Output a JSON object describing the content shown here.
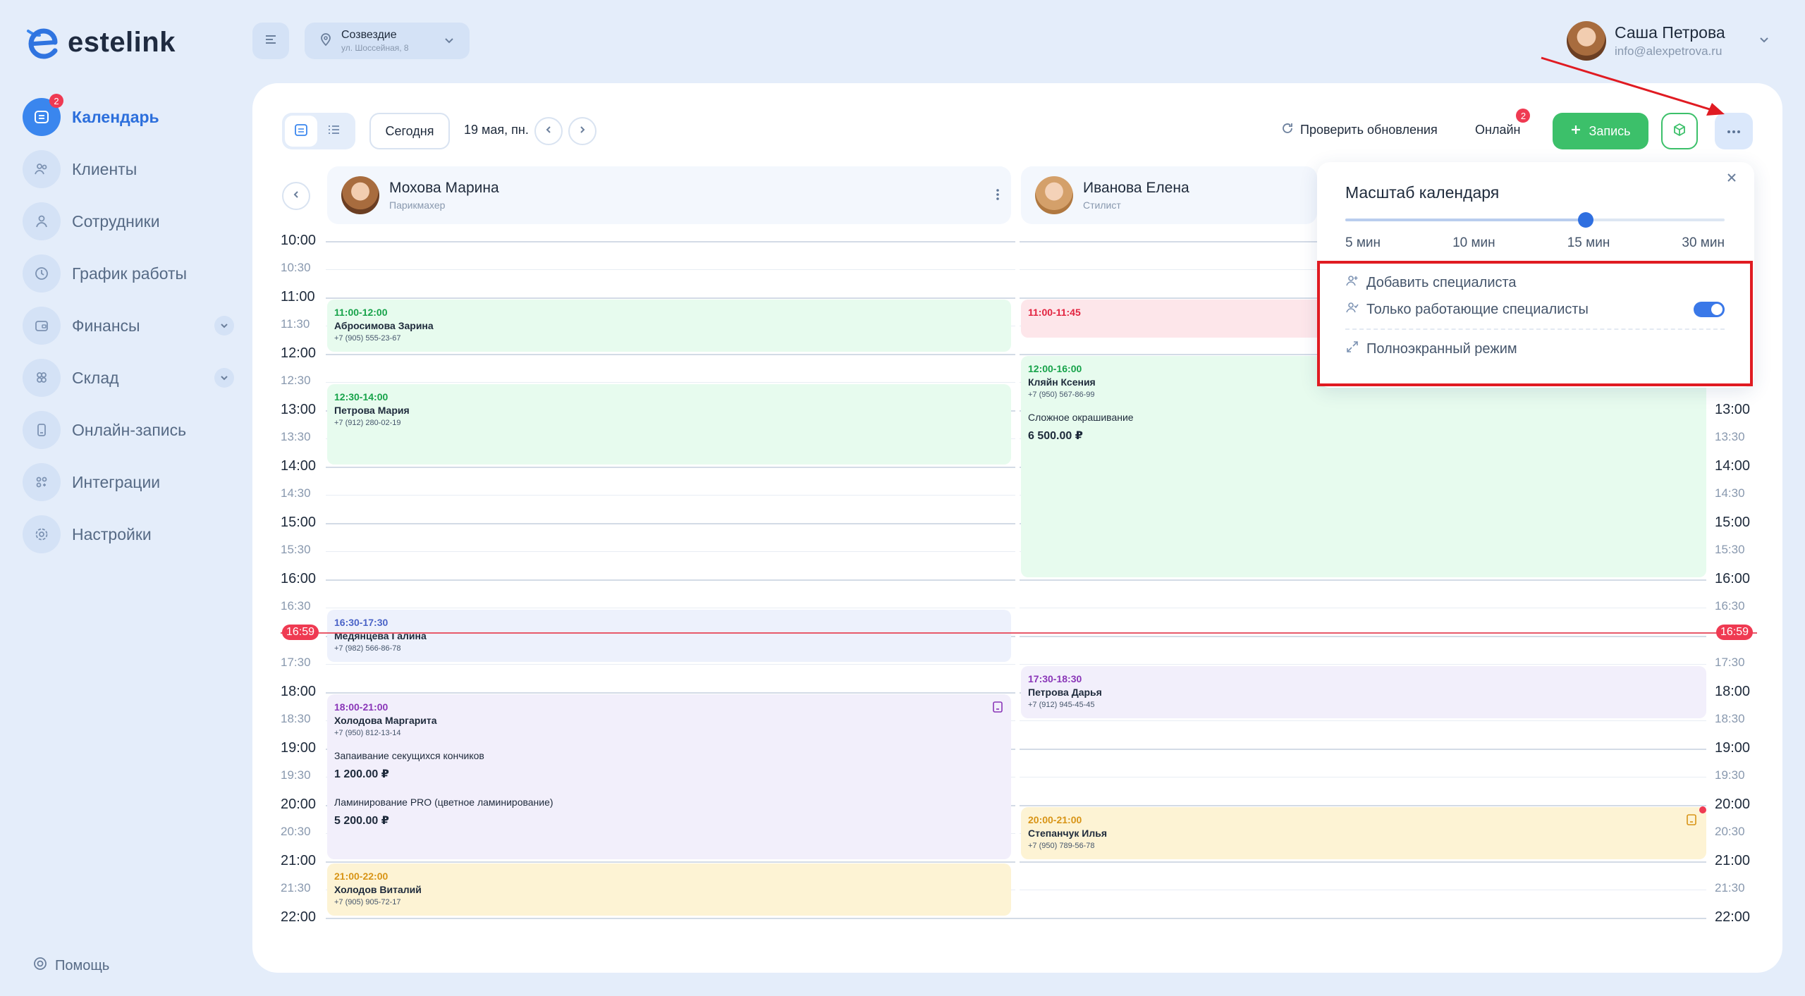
{
  "brand": {
    "name": "estelink"
  },
  "sidebar": {
    "items": [
      {
        "label": "Календарь",
        "icon": "calendar-icon",
        "active": true,
        "badge": "2"
      },
      {
        "label": "Клиенты",
        "icon": "clients-icon"
      },
      {
        "label": "Сотрудники",
        "icon": "staff-icon"
      },
      {
        "label": "График работы",
        "icon": "clock-icon"
      },
      {
        "label": "Финансы",
        "icon": "wallet-icon",
        "expandable": true
      },
      {
        "label": "Склад",
        "icon": "warehouse-icon",
        "expandable": true
      },
      {
        "label": "Онлайн-запись",
        "icon": "phone-icon"
      },
      {
        "label": "Интеграции",
        "icon": "integrations-icon"
      },
      {
        "label": "Настройки",
        "icon": "settings-icon"
      }
    ],
    "help": "Помощь"
  },
  "topbar": {
    "location_name": "Созвездие",
    "location_address": "ул. Шоссейная, 8",
    "user_name": "Саша Петрова",
    "user_email": "info@alexpetrova.ru"
  },
  "toolbar": {
    "today": "Сегодня",
    "date": "19 мая, пн.",
    "check_updates": "Проверить обновления",
    "online": "Онлайн",
    "online_badge": "2",
    "new_record": "Запись"
  },
  "times": [
    "10:00",
    "10:30",
    "11:00",
    "11:30",
    "12:00",
    "12:30",
    "13:00",
    "13:30",
    "14:00",
    "14:30",
    "15:00",
    "15:30",
    "16:00",
    "16:30",
    "17:00",
    "17:30",
    "18:00",
    "18:30",
    "19:00",
    "19:30",
    "20:00",
    "20:30",
    "21:00",
    "21:30",
    "22:00"
  ],
  "now": "16:59",
  "columns": [
    {
      "name": "Мохова Марина",
      "role": "Парикмахер"
    },
    {
      "name": "Иванова Елена",
      "role": "Стилист"
    }
  ],
  "events": [
    {
      "col": 0,
      "time": "11:00-12:00",
      "name": "Абросимова Зарина",
      "phone": "+7 (905) 555-23-67",
      "color": "green"
    },
    {
      "col": 0,
      "time": "12:30-14:00",
      "name": "Петрова Мария",
      "phone": "+7 (912) 280-02-19",
      "color": "green"
    },
    {
      "col": 0,
      "time": "16:30-17:30",
      "name": "Медянцева Галина",
      "phone": "+7 (982) 566-86-78",
      "color": "blue"
    },
    {
      "col": 0,
      "time": "18:00-21:00",
      "name": "Холодова Маргарита",
      "phone": "+7 (950) 812-13-14",
      "color": "purple",
      "services": [
        {
          "title": "Запаивание секущихся кончиков",
          "price": "1 200.00 ₽"
        },
        {
          "title": "Ламинирование PRO (цветное ламинирование)",
          "price": "5 200.00 ₽"
        }
      ]
    },
    {
      "col": 0,
      "time": "21:00-22:00",
      "name": "Холодов Виталий",
      "phone": "+7 (905) 905-72-17",
      "color": "yellow"
    },
    {
      "col": 1,
      "time": "11:00-11:45",
      "color": "red"
    },
    {
      "col": 1,
      "time": "12:00-16:00",
      "name": "Кляйн Ксения",
      "phone": "+7 (950) 567-86-99",
      "color": "green",
      "services": [
        {
          "title": "Сложное окрашивание",
          "price": "6 500.00 ₽"
        }
      ]
    },
    {
      "col": 1,
      "time": "17:30-18:30",
      "name": "Петрова Дарья",
      "phone": "+7 (912) 945-45-45",
      "color": "purple"
    },
    {
      "col": 1,
      "time": "20:00-21:00",
      "name": "Степанчук Илья",
      "phone": "+7 (950) 789-56-78",
      "color": "yellow"
    }
  ],
  "popup": {
    "title": "Масштаб календаря",
    "scale_options": [
      "5 мин",
      "10 мин",
      "15 мин",
      "30 мин"
    ],
    "selected_scale": "15 мин",
    "add_specialist": "Добавить специалиста",
    "only_working": "Только работающие специалисты",
    "only_working_on": true,
    "fullscreen": "Полноэкранный режим"
  },
  "colors": {
    "accent": "#3a86ee",
    "green_btn": "#3cc06a",
    "badge": "#ef3a52",
    "annotation": "#e01b22"
  }
}
